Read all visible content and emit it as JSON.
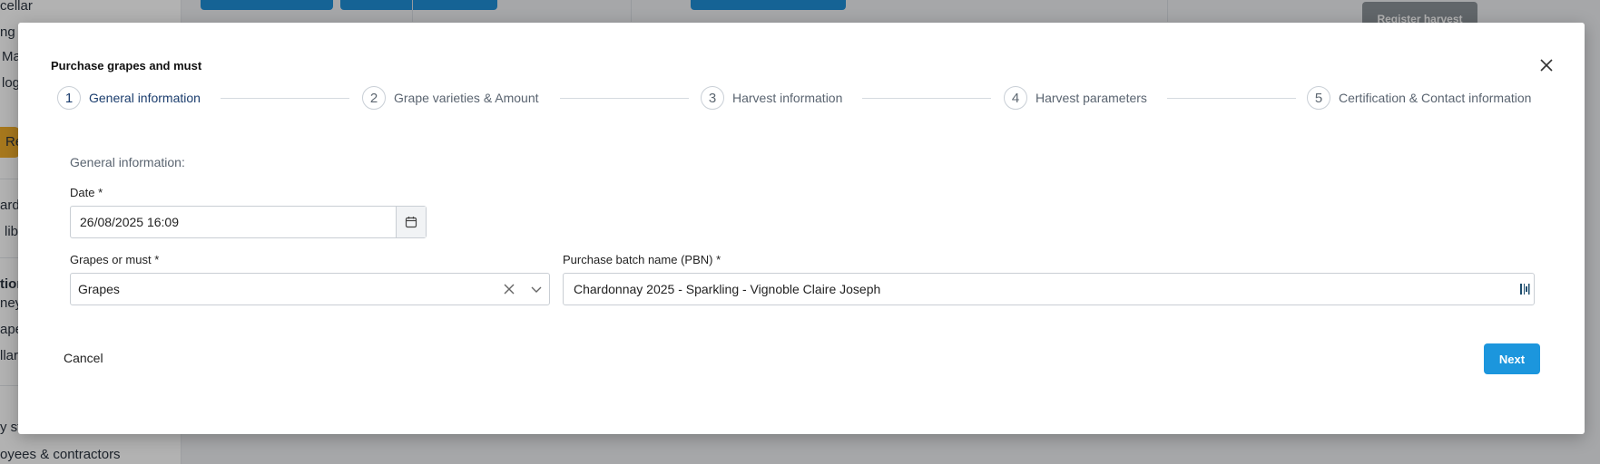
{
  "background": {
    "sidebar_items": [
      "cellar",
      "ng",
      "Ma",
      "log",
      "Re",
      "ard",
      "lib",
      "tion",
      "ney",
      "ape",
      "llar",
      "y st",
      "oyees & contractors"
    ],
    "register_harvest_label": "Register harvest"
  },
  "modal": {
    "title": "Purchase grapes and must",
    "steps": [
      {
        "number": "1",
        "label": "General information"
      },
      {
        "number": "2",
        "label": "Grape varieties & Amount"
      },
      {
        "number": "3",
        "label": "Harvest information"
      },
      {
        "number": "4",
        "label": "Harvest parameters"
      },
      {
        "number": "5",
        "label": "Certification & Contact information"
      }
    ],
    "active_step": 1,
    "section_title": "General information:",
    "date": {
      "label": "Date *",
      "value": "26/08/2025 16:09"
    },
    "grapes_or_must": {
      "label": "Grapes or must *",
      "value": "Grapes"
    },
    "pbn": {
      "label": "Purchase batch name (PBN) *",
      "value": "Chardonnay 2025 - Sparkling - Vignoble Claire Joseph"
    },
    "cancel_label": "Cancel",
    "next_label": "Next"
  },
  "colors": {
    "primary": "#1c96dd",
    "active_step": "#1b3d6d",
    "badge": "#f0ad2a"
  }
}
